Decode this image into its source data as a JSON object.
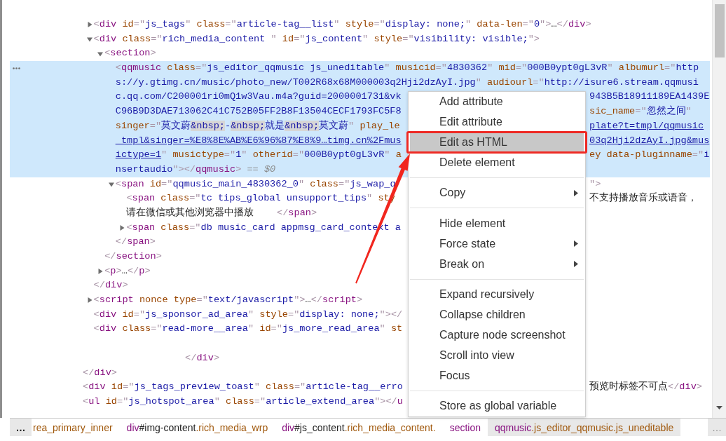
{
  "dom_tree": [
    {
      "kind": "partial",
      "children": [
        {
          "kind": "expandable",
          "expanded": false,
          "selected": false,
          "lines": [
            {
              "kind": "code",
              "left": [
                {
                  "kind": "punct",
                  "text": "<"
                },
                {
                  "kind": "tag",
                  "text": "div"
                },
                {
                  "kind": "attr",
                  "text": " id"
                },
                {
                  "kind": "punct",
                  "text": "=\""
                },
                {
                  "kind": "value",
                  "text": "js_tags"
                },
                {
                  "kind": "punct",
                  "text": "\""
                },
                {
                  "kind": "attr",
                  "text": " class"
                },
                {
                  "kind": "punct",
                  "text": "=\""
                },
                {
                  "kind": "value",
                  "text": "article-tag__list"
                },
                {
                  "kind": "punct",
                  "text": "\""
                },
                {
                  "kind": "attr",
                  "text": " style"
                },
                {
                  "kind": "punct",
                  "text": "=\""
                },
                {
                  "kind": "value",
                  "text": "display: none;"
                },
                {
                  "kind": "punct",
                  "text": "\""
                },
                {
                  "kind": "attr",
                  "text": " data-len"
                },
                {
                  "kind": "punct",
                  "text": "=\""
                },
                {
                  "kind": "value",
                  "text": "0"
                },
                {
                  "kind": "punct",
                  "text": "\">"
                },
                {
                  "kind": "text",
                  "text": "…"
                },
                {
                  "kind": "punct",
                  "text": "</"
                },
                {
                  "kind": "tag",
                  "text": "div"
                },
                {
                  "kind": "punct",
                  "text": ">"
                }
              ]
            }
          ]
        },
        {
          "kind": "expandable",
          "expanded": true,
          "selected": false,
          "lines": [
            {
              "kind": "code",
              "left": [
                {
                  "kind": "punct",
                  "text": "<"
                },
                {
                  "kind": "tag",
                  "text": "div"
                },
                {
                  "kind": "attr",
                  "text": " class"
                },
                {
                  "kind": "punct",
                  "text": "=\""
                },
                {
                  "kind": "value",
                  "text": "rich_media_content "
                },
                {
                  "kind": "punct",
                  "text": "\""
                },
                {
                  "kind": "attr",
                  "text": " id"
                },
                {
                  "kind": "punct",
                  "text": "=\""
                },
                {
                  "kind": "value",
                  "text": "js_content"
                },
                {
                  "kind": "punct",
                  "text": "\""
                },
                {
                  "kind": "attr",
                  "text": " style"
                },
                {
                  "kind": "punct",
                  "text": "=\""
                },
                {
                  "kind": "value",
                  "text": "visibility: visible;"
                },
                {
                  "kind": "punct",
                  "text": "\">"
                }
              ]
            }
          ],
          "children": [
            {
              "kind": "expandable",
              "expanded": true,
              "selected": false,
              "lines": [
                {
                  "kind": "code",
                  "left": [
                    {
                      "kind": "punct",
                      "text": "<"
                    },
                    {
                      "kind": "tag",
                      "text": "section"
                    },
                    {
                      "kind": "punct",
                      "text": ">"
                    }
                  ]
                }
              ],
              "children": [
                {
                  "kind": "leaf",
                  "selected": true,
                  "lines": [
                    {
                      "kind": "code",
                      "left": [
                        {
                          "kind": "punct",
                          "text": "<"
                        },
                        {
                          "kind": "tag",
                          "text": "qqmusic"
                        },
                        {
                          "kind": "attr",
                          "text": " class"
                        },
                        {
                          "kind": "punct",
                          "text": "=\""
                        },
                        {
                          "kind": "value",
                          "text": "js_editor_qqmusic js_uneditable"
                        },
                        {
                          "kind": "punct",
                          "text": "\""
                        },
                        {
                          "kind": "attr",
                          "text": " musicid"
                        },
                        {
                          "kind": "punct",
                          "text": "=\""
                        },
                        {
                          "kind": "value",
                          "text": "4830362"
                        },
                        {
                          "kind": "punct",
                          "text": "\""
                        },
                        {
                          "kind": "attr",
                          "text": " mid"
                        },
                        {
                          "kind": "punct",
                          "text": "=\""
                        },
                        {
                          "kind": "value",
                          "text": "000B0ypt0gL3vR"
                        },
                        {
                          "kind": "punct",
                          "text": "\""
                        },
                        {
                          "kind": "attr",
                          "text": " albumurl"
                        },
                        {
                          "kind": "punct",
                          "text": "=\""
                        },
                        {
                          "kind": "value",
                          "text": "http"
                        }
                      ]
                    },
                    {
                      "kind": "code",
                      "left": [
                        {
                          "kind": "value",
                          "text": "s://y.gtimg.cn/music/photo_new/T002R68x68M000003q2Hji2dzAyI.jpg"
                        },
                        {
                          "kind": "punct",
                          "text": "\""
                        },
                        {
                          "kind": "attr",
                          "text": " audiourl"
                        },
                        {
                          "kind": "punct",
                          "text": "=\""
                        },
                        {
                          "kind": "value",
                          "text": "http://isure6.stream.qqmusi"
                        }
                      ]
                    },
                    {
                      "kind": "code",
                      "left": [
                        {
                          "kind": "value",
                          "text": "c.qq.com/C200001ri0mQ1w3Vau.m4a?guid=2000001731&vk"
                        }
                      ],
                      "right": [
                        {
                          "kind": "value",
                          "text": "943B5B18911189EA1439E"
                        }
                      ]
                    },
                    {
                      "kind": "code",
                      "left": [
                        {
                          "kind": "value",
                          "text": "C96B9D3DAE713062C41C752B05FF2B8F13504CECF1793FC5F8"
                        }
                      ],
                      "right": [
                        {
                          "kind": "attr",
                          "text": "sic_name"
                        },
                        {
                          "kind": "punct",
                          "text": "=\""
                        },
                        {
                          "kind": "value",
                          "text": "忽然之间"
                        },
                        {
                          "kind": "punct",
                          "text": "\""
                        }
                      ]
                    },
                    {
                      "kind": "code",
                      "left": [
                        {
                          "kind": "attr",
                          "text": "singer"
                        },
                        {
                          "kind": "punct",
                          "text": "=\""
                        },
                        {
                          "kind": "value",
                          "text": "莫文蔚"
                        },
                        {
                          "kind": "entity",
                          "text": "&nbsp;"
                        },
                        {
                          "kind": "value",
                          "text": "-"
                        },
                        {
                          "kind": "entity",
                          "text": "&nbsp;"
                        },
                        {
                          "kind": "value",
                          "text": "就是"
                        },
                        {
                          "kind": "entity",
                          "text": "&nbsp;"
                        },
                        {
                          "kind": "value",
                          "text": "莫文蔚"
                        },
                        {
                          "kind": "punct",
                          "text": "\""
                        },
                        {
                          "kind": "attr",
                          "text": " play_le"
                        }
                      ],
                      "right": [
                        {
                          "kind": "link",
                          "text": "plate?t=tmpl/qqmusic"
                        }
                      ]
                    },
                    {
                      "kind": "code",
                      "left": [
                        {
                          "kind": "link",
                          "text": "_tmpl&singer=%E8%8E%AB%E6%96%87%E8%9…timg.cn%2Fmus"
                        }
                      ],
                      "right": [
                        {
                          "kind": "link",
                          "text": "03q2Hji2dzAyI.jpg&mus"
                        }
                      ]
                    },
                    {
                      "kind": "code",
                      "left": [
                        {
                          "kind": "link",
                          "text": "ictype=1"
                        },
                        {
                          "kind": "punct",
                          "text": "\""
                        },
                        {
                          "kind": "attr",
                          "text": " musictype"
                        },
                        {
                          "kind": "punct",
                          "text": "=\""
                        },
                        {
                          "kind": "value",
                          "text": "1"
                        },
                        {
                          "kind": "punct",
                          "text": "\""
                        },
                        {
                          "kind": "attr",
                          "text": " otherid"
                        },
                        {
                          "kind": "punct",
                          "text": "=\""
                        },
                        {
                          "kind": "value",
                          "text": "000B0ypt0gL3vR"
                        },
                        {
                          "kind": "punct",
                          "text": "\""
                        },
                        {
                          "kind": "attr",
                          "text": " a"
                        }
                      ],
                      "right": [
                        {
                          "kind": "attr",
                          "text": "ey data-pluginname"
                        },
                        {
                          "kind": "punct",
                          "text": "=\""
                        },
                        {
                          "kind": "value",
                          "text": "i"
                        }
                      ]
                    },
                    {
                      "kind": "code",
                      "left": [
                        {
                          "kind": "value",
                          "text": "nsertaudio"
                        },
                        {
                          "kind": "punct",
                          "text": "\"></"
                        },
                        {
                          "kind": "tag",
                          "text": "qqmusic"
                        },
                        {
                          "kind": "punct",
                          "text": ">"
                        },
                        {
                          "kind": "console",
                          "text": " == *$0*"
                        }
                      ]
                    }
                  ]
                },
                {
                  "kind": "expandable",
                  "expanded": true,
                  "selected": false,
                  "lines": [
                    {
                      "kind": "code",
                      "left": [
                        {
                          "kind": "punct",
                          "text": "<"
                        },
                        {
                          "kind": "tag",
                          "text": "span"
                        },
                        {
                          "kind": "attr",
                          "text": " id"
                        },
                        {
                          "kind": "punct",
                          "text": "=\""
                        },
                        {
                          "kind": "value",
                          "text": "qqmusic_main_4830362_0"
                        },
                        {
                          "kind": "punct",
                          "text": "\""
                        },
                        {
                          "kind": "attr",
                          "text": " class"
                        },
                        {
                          "kind": "punct",
                          "text": "=\""
                        },
                        {
                          "kind": "value",
                          "text": "js_wap_q"
                        }
                      ],
                      "right": [
                        {
                          "kind": "punct",
                          "text": "\">"
                        }
                      ]
                    }
                  ],
                  "children": [
                    {
                      "kind": "leaf",
                      "selected": false,
                      "lines": [
                        {
                          "kind": "code",
                          "left": [
                            {
                              "kind": "punct",
                              "text": "<"
                            },
                            {
                              "kind": "tag",
                              "text": "span"
                            },
                            {
                              "kind": "attr",
                              "text": " class"
                            },
                            {
                              "kind": "punct",
                              "text": "=\""
                            },
                            {
                              "kind": "value",
                              "text": "tc tips_global unsupport_tips"
                            },
                            {
                              "kind": "punct",
                              "text": "\""
                            },
                            {
                              "kind": "attr",
                              "text": " sty"
                            }
                          ],
                          "right": [
                            {
                              "kind": "text",
                              "text": "不支持播放音乐或语音，"
                            }
                          ]
                        },
                        {
                          "kind": "code",
                          "left": [
                            {
                              "kind": "text",
                              "text": "请在微信或其他浏览器中播放    "
                            },
                            {
                              "kind": "punct",
                              "text": "</"
                            },
                            {
                              "kind": "tag",
                              "text": "span"
                            },
                            {
                              "kind": "punct",
                              "text": ">"
                            }
                          ]
                        }
                      ]
                    },
                    {
                      "kind": "expandable",
                      "expanded": false,
                      "selected": false,
                      "lines": [
                        {
                          "kind": "code",
                          "left": [
                            {
                              "kind": "punct",
                              "text": "<"
                            },
                            {
                              "kind": "tag",
                              "text": "span"
                            },
                            {
                              "kind": "attr",
                              "text": " class"
                            },
                            {
                              "kind": "punct",
                              "text": "=\""
                            },
                            {
                              "kind": "value",
                              "text": "db music_card appmsg_card_context a"
                            }
                          ]
                        }
                      ]
                    }
                  ],
                  "closing": {
                    "kind": "code",
                    "left": [
                      {
                        "kind": "punct",
                        "text": "</"
                      },
                      {
                        "kind": "tag",
                        "text": "span"
                      },
                      {
                        "kind": "punct",
                        "text": ">"
                      }
                    ]
                  }
                }
              ],
              "closing": {
                "kind": "code",
                "left": [
                  {
                    "kind": "punct",
                    "text": "</"
                  },
                  {
                    "kind": "tag",
                    "text": "section"
                  },
                  {
                    "kind": "punct",
                    "text": ">"
                  }
                ]
              }
            },
            {
              "kind": "expandable",
              "expanded": false,
              "selected": false,
              "lines": [
                {
                  "kind": "code",
                  "left": [
                    {
                      "kind": "punct",
                      "text": "<"
                    },
                    {
                      "kind": "tag",
                      "text": "p"
                    },
                    {
                      "kind": "punct",
                      "text": ">"
                    },
                    {
                      "kind": "text",
                      "text": "…"
                    },
                    {
                      "kind": "punct",
                      "text": "</"
                    },
                    {
                      "kind": "tag",
                      "text": "p"
                    },
                    {
                      "kind": "punct",
                      "text": ">"
                    }
                  ]
                }
              ]
            }
          ],
          "closing": {
            "kind": "code",
            "left": [
              {
                "kind": "punct",
                "text": "</"
              },
              {
                "kind": "tag",
                "text": "div"
              },
              {
                "kind": "punct",
                "text": ">"
              }
            ]
          }
        },
        {
          "kind": "expandable",
          "expanded": false,
          "selected": false,
          "lines": [
            {
              "kind": "code",
              "left": [
                {
                  "kind": "punct",
                  "text": "<"
                },
                {
                  "kind": "tag",
                  "text": "script"
                },
                {
                  "kind": "attr",
                  "text": " nonce"
                },
                {
                  "kind": "attr",
                  "text": " type"
                },
                {
                  "kind": "punct",
                  "text": "=\""
                },
                {
                  "kind": "value",
                  "text": "text/javascript"
                },
                {
                  "kind": "punct",
                  "text": "\">"
                },
                {
                  "kind": "text",
                  "text": "…"
                },
                {
                  "kind": "punct",
                  "text": "</"
                },
                {
                  "kind": "tag",
                  "text": "script"
                },
                {
                  "kind": "punct",
                  "text": ">"
                }
              ]
            }
          ]
        },
        {
          "kind": "leaf",
          "selected": false,
          "lines": [
            {
              "kind": "code",
              "left": [
                {
                  "kind": "punct",
                  "text": "<"
                },
                {
                  "kind": "tag",
                  "text": "div"
                },
                {
                  "kind": "attr",
                  "text": " id"
                },
                {
                  "kind": "punct",
                  "text": "=\""
                },
                {
                  "kind": "value",
                  "text": "js_sponsor_ad_area"
                },
                {
                  "kind": "punct",
                  "text": "\""
                },
                {
                  "kind": "attr",
                  "text": " style"
                },
                {
                  "kind": "punct",
                  "text": "=\""
                },
                {
                  "kind": "value",
                  "text": "display: none;"
                },
                {
                  "kind": "punct",
                  "text": "\"></"
                }
              ]
            }
          ]
        },
        {
          "kind": "leaf",
          "selected": false,
          "lines": [
            {
              "kind": "code",
              "left": [
                {
                  "kind": "punct",
                  "text": "<"
                },
                {
                  "kind": "tag",
                  "text": "div"
                },
                {
                  "kind": "attr",
                  "text": " class"
                },
                {
                  "kind": "punct",
                  "text": "=\""
                },
                {
                  "kind": "value",
                  "text": "read-more__area"
                },
                {
                  "kind": "punct",
                  "text": "\""
                },
                {
                  "kind": "attr",
                  "text": " id"
                },
                {
                  "kind": "punct",
                  "text": "=\""
                },
                {
                  "kind": "value",
                  "text": "js_more_read_area"
                },
                {
                  "kind": "punct",
                  "text": "\""
                },
                {
                  "kind": "attr",
                  "text": " st"
                }
              ]
            },
            {
              "kind": "blank"
            },
            {
              "kind": "indented",
              "left": [
                {
                  "kind": "punct",
                  "text": "</"
                },
                {
                  "kind": "tag",
                  "text": "div"
                },
                {
                  "kind": "punct",
                  "text": ">"
                }
              ]
            }
          ]
        }
      ],
      "closing": {
        "kind": "code",
        "left": [
          {
            "kind": "punct",
            "text": "</"
          },
          {
            "kind": "tag",
            "text": "div"
          },
          {
            "kind": "punct",
            "text": ">"
          }
        ]
      }
    },
    {
      "kind": "leaf",
      "selected": false,
      "lines": [
        {
          "kind": "code",
          "left": [
            {
              "kind": "punct",
              "text": "<"
            },
            {
              "kind": "tag",
              "text": "div"
            },
            {
              "kind": "attr",
              "text": " id"
            },
            {
              "kind": "punct",
              "text": "=\""
            },
            {
              "kind": "value",
              "text": "js_tags_preview_toast"
            },
            {
              "kind": "punct",
              "text": "\""
            },
            {
              "kind": "attr",
              "text": " class"
            },
            {
              "kind": "punct",
              "text": "=\""
            },
            {
              "kind": "value",
              "text": "article-tag__erro"
            }
          ],
          "right": [
            {
              "kind": "text",
              "text": "预览时标签不可点"
            },
            {
              "kind": "punct",
              "text": "</"
            },
            {
              "kind": "tag",
              "text": "div"
            },
            {
              "kind": "punct",
              "text": ">"
            }
          ]
        }
      ]
    },
    {
      "kind": "leaf",
      "selected": false,
      "lines": [
        {
          "kind": "code",
          "left": [
            {
              "kind": "punct",
              "text": "<"
            },
            {
              "kind": "tag",
              "text": "ul"
            },
            {
              "kind": "attr",
              "text": " id"
            },
            {
              "kind": "punct",
              "text": "=\""
            },
            {
              "kind": "value",
              "text": "js_hotspot_area"
            },
            {
              "kind": "punct",
              "text": "\""
            },
            {
              "kind": "attr",
              "text": " class"
            },
            {
              "kind": "punct",
              "text": "=\""
            },
            {
              "kind": "value",
              "text": "article_extend_area"
            },
            {
              "kind": "punct",
              "text": "\"></"
            },
            {
              "kind": "tag",
              "text": "u"
            }
          ]
        }
      ]
    }
  ],
  "context_menu": {
    "groups": [
      {
        "items": [
          {
            "label": "Add attribute",
            "selected": false,
            "has_submenu": false,
            "framed": false
          },
          {
            "label": "Edit attribute",
            "selected": false,
            "has_submenu": false,
            "framed": false
          },
          {
            "label": "Edit as HTML",
            "selected": true,
            "has_submenu": false,
            "framed": true
          },
          {
            "label": "Delete element",
            "selected": false,
            "has_submenu": false,
            "framed": false
          }
        ]
      },
      {
        "items": [
          {
            "label": "Copy",
            "selected": false,
            "has_submenu": true,
            "framed": false
          }
        ]
      },
      {
        "items": [
          {
            "label": "Hide element",
            "selected": false,
            "has_submenu": false,
            "framed": false
          },
          {
            "label": "Force state",
            "selected": false,
            "has_submenu": true,
            "framed": false
          },
          {
            "label": "Break on",
            "selected": false,
            "has_submenu": true,
            "framed": false
          }
        ]
      },
      {
        "items": [
          {
            "label": "Expand recursively",
            "selected": false,
            "has_submenu": false,
            "framed": false
          },
          {
            "label": "Collapse children",
            "selected": false,
            "has_submenu": false,
            "framed": false
          },
          {
            "label": "Capture node screenshot",
            "selected": false,
            "has_submenu": false,
            "framed": false
          },
          {
            "label": "Scroll into view",
            "selected": false,
            "has_submenu": false,
            "framed": false
          },
          {
            "label": "Focus",
            "selected": false,
            "has_submenu": false,
            "framed": false
          }
        ]
      },
      {
        "items": [
          {
            "label": "Store as global variable",
            "selected": false,
            "has_submenu": false,
            "framed": false
          }
        ]
      }
    ]
  },
  "breadcrumbs": {
    "scroll_left": "…",
    "items": [
      {
        "selected": false,
        "parts": [
          {
            "kind": "class",
            "text": "rea_primary_inner"
          }
        ]
      },
      {
        "selected": false,
        "parts": [
          {
            "kind": "tag",
            "text": "div"
          },
          {
            "kind": "id",
            "text": "#img-content"
          },
          {
            "kind": "class",
            "text": ".rich_media_wrp"
          }
        ]
      },
      {
        "selected": false,
        "parts": [
          {
            "kind": "tag",
            "text": "div"
          },
          {
            "kind": "id",
            "text": "#js_content"
          },
          {
            "kind": "class",
            "text": ".rich_media_content."
          }
        ]
      },
      {
        "selected": false,
        "parts": [
          {
            "kind": "tag",
            "text": "section"
          }
        ]
      },
      {
        "selected": true,
        "parts": [
          {
            "kind": "tag",
            "text": "qqmusic"
          },
          {
            "kind": "class",
            "text": ".js_editor_qqmusic.js_uneditable"
          }
        ]
      }
    ],
    "scroll_right": "…"
  }
}
